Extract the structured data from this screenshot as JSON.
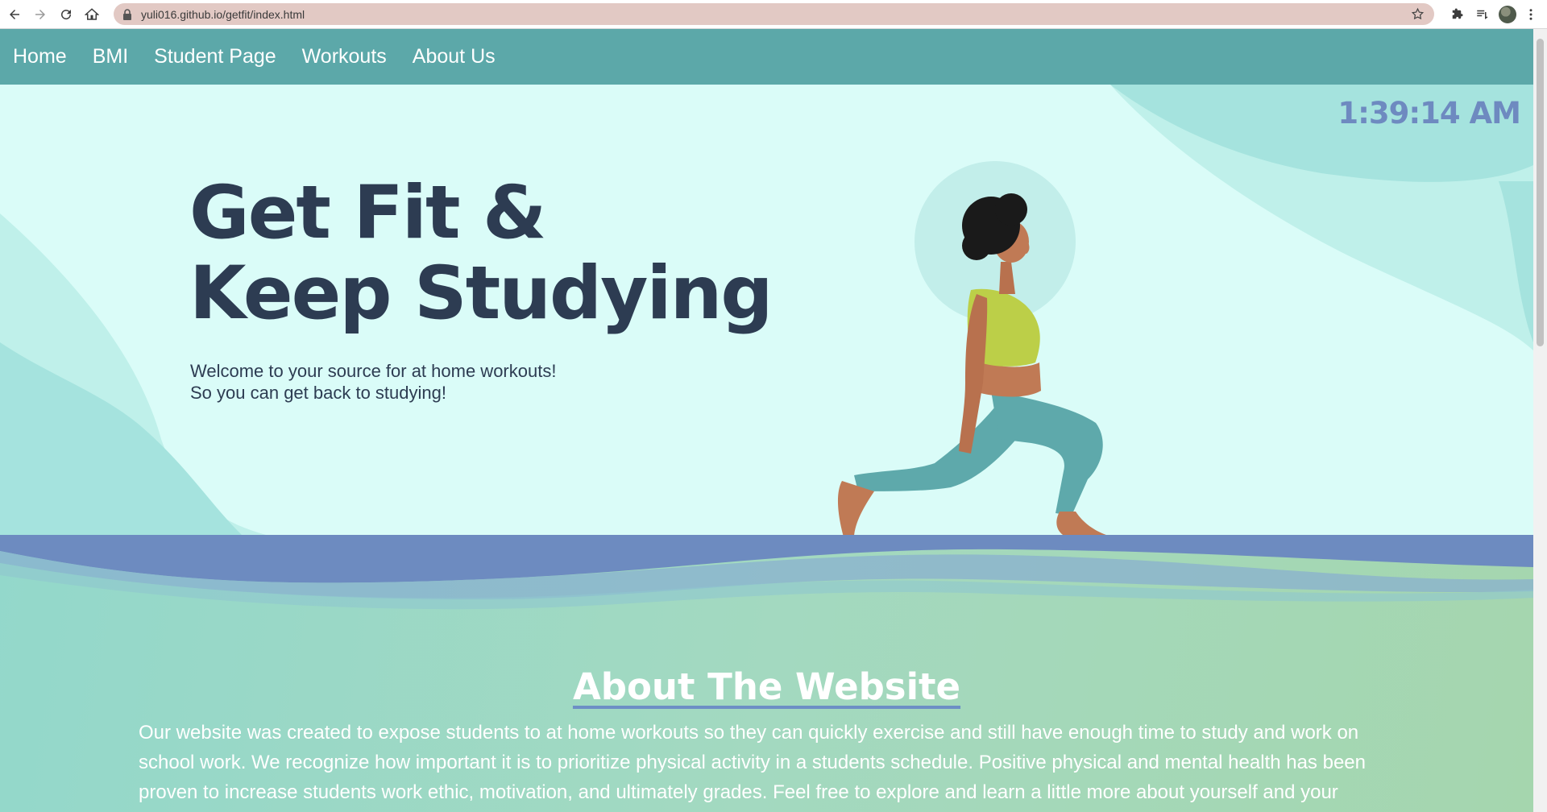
{
  "browser": {
    "url": "yuli016.github.io/getfit/index.html",
    "icons": [
      "back-icon",
      "forward-icon",
      "reload-icon",
      "home-icon",
      "lock-icon",
      "star-icon",
      "extensions-icon",
      "reading-list-icon",
      "profile-avatar",
      "menu-icon"
    ]
  },
  "nav": {
    "items": [
      {
        "label": "Home"
      },
      {
        "label": "BMI"
      },
      {
        "label": "Student Page"
      },
      {
        "label": "Workouts"
      },
      {
        "label": "About Us"
      }
    ]
  },
  "hero": {
    "clock": "1:39:14 AM",
    "headline_line1": "Get Fit &",
    "headline_line2": "Keep Studying",
    "sub_line1": "Welcome to your source for at home workouts!",
    "sub_line2": "So you can get back to studying!"
  },
  "about": {
    "title": "About The Website",
    "text": "Our website was created to expose students to at home workouts so they can quickly exercise and still have enough time to study and work on school work. We recognize how important it is to prioritize physical activity in a students schedule. Positive physical and mental health has been proven to increase students work ethic, motivation, and ultimately grades. Feel free to explore and learn a little more about yourself and your"
  },
  "colors": {
    "nav": "#5ca8a9",
    "hero_bg": "#dafcf8",
    "headline": "#2d3c52",
    "clock": "#6e8ac0",
    "wave_blue": "#6d8bc0"
  }
}
